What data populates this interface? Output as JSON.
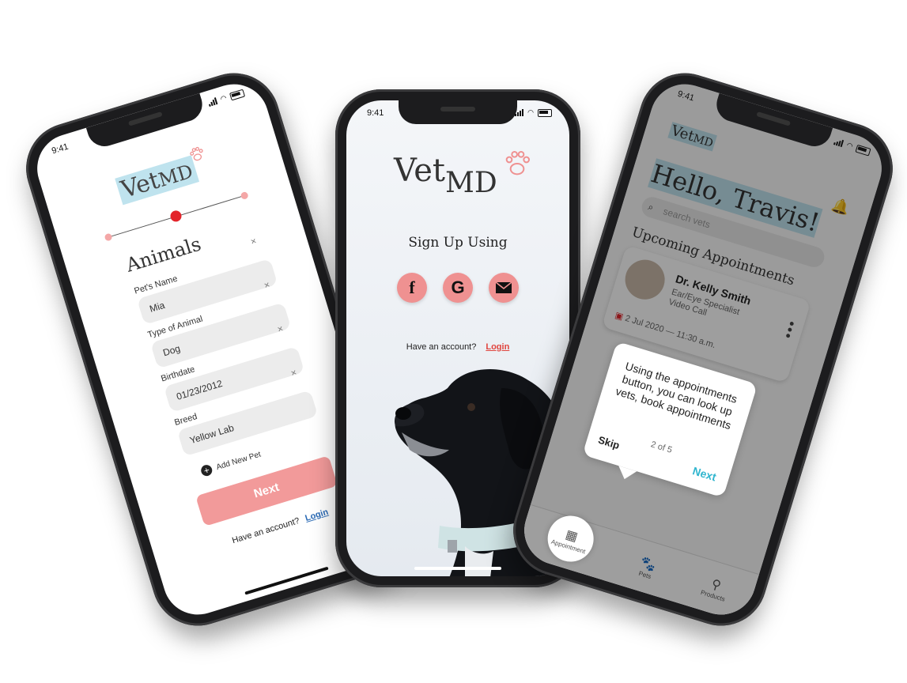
{
  "status": {
    "time": "9:41"
  },
  "brand": {
    "name_part1": "Vet",
    "name_part2": "MD",
    "accent": "#ef9191",
    "highlight": "#bfe3ee"
  },
  "screen1": {
    "heading": "Animals",
    "fields": [
      {
        "label": "Pet's Name",
        "value": "Mia"
      },
      {
        "label": "Type of Animal",
        "value": "Dog"
      },
      {
        "label": "Birthdate",
        "value": "01/23/2012"
      },
      {
        "label": "Breed",
        "value": "Yellow Lab"
      }
    ],
    "add_pet": "Add New Pet",
    "next": "Next",
    "have_account": "Have an account?",
    "login": "Login"
  },
  "screen2": {
    "signup": "Sign Up Using",
    "social": [
      "f",
      "G"
    ],
    "have_account": "Have an account?",
    "login": "Login"
  },
  "screen3": {
    "greeting": "Hello, Travis!",
    "search_placeholder": "search vets",
    "upcoming": "Upcoming Appointments",
    "doctor": "Dr. Kelly Smith",
    "specialty": "Ear/Eye Specialist",
    "visit_type": "Video Call",
    "date": "2 Jul 2020 — 11:30 a.m.",
    "tooltip": "Using the appointments button, you can look up vets, book appointments",
    "tooltip_count": "2 of 5",
    "skip": "Skip",
    "next": "Next",
    "tabs": [
      "Appointment",
      "Pets",
      "Products"
    ]
  }
}
